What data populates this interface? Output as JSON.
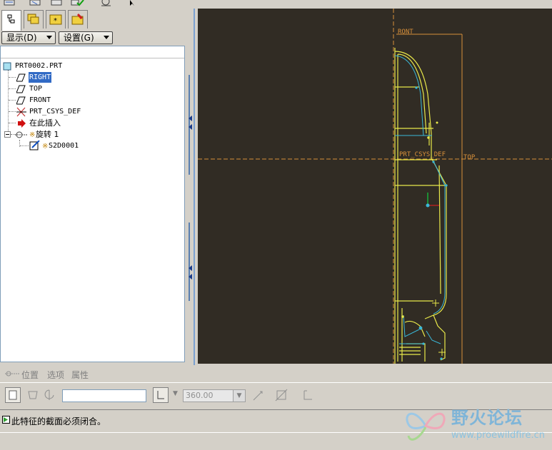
{
  "toolbar": {
    "icons": [
      "new-icon",
      "open-icon",
      "save-icon",
      "regen-icon",
      "sketch-icon",
      "select-arrow-icon"
    ]
  },
  "tabs": [
    "model-tree-tab",
    "layers-tab",
    "favorites-tab",
    "connections-tab"
  ],
  "tree_controls": {
    "display_label": "显示(D)",
    "settings_label": "设置(G)"
  },
  "tree": {
    "root": "PRT0002.PRT",
    "items": [
      {
        "label": "RIGHT",
        "icon": "datum-plane-icon",
        "selected": true
      },
      {
        "label": "TOP",
        "icon": "datum-plane-icon"
      },
      {
        "label": "FRONT",
        "icon": "datum-plane-icon"
      },
      {
        "label": "PRT_CSYS_DEF",
        "icon": "csys-icon"
      },
      {
        "label": "在此插入",
        "icon": "insert-arrow-icon"
      },
      {
        "label": "旋转 1",
        "icon": "revolve-icon"
      },
      {
        "label": "S2D0001",
        "icon": "sketch-icon"
      }
    ]
  },
  "canvas": {
    "label_front": "RONT",
    "label_csys": "PRT_CSYS_DEF",
    "label_top": "TOP",
    "colors": {
      "background": "#312c24",
      "geometry": "#e8e84a",
      "datum": "#d8903a",
      "highlight": "#3ab8d8"
    }
  },
  "dashboard": {
    "tabs": [
      "位置",
      "选项",
      "属性"
    ],
    "angle_value": "360.00"
  },
  "status": {
    "message": "此特征的截面必须闭合。"
  },
  "watermark": {
    "title": "野火论坛",
    "url": "www.proewildfire.cn"
  }
}
